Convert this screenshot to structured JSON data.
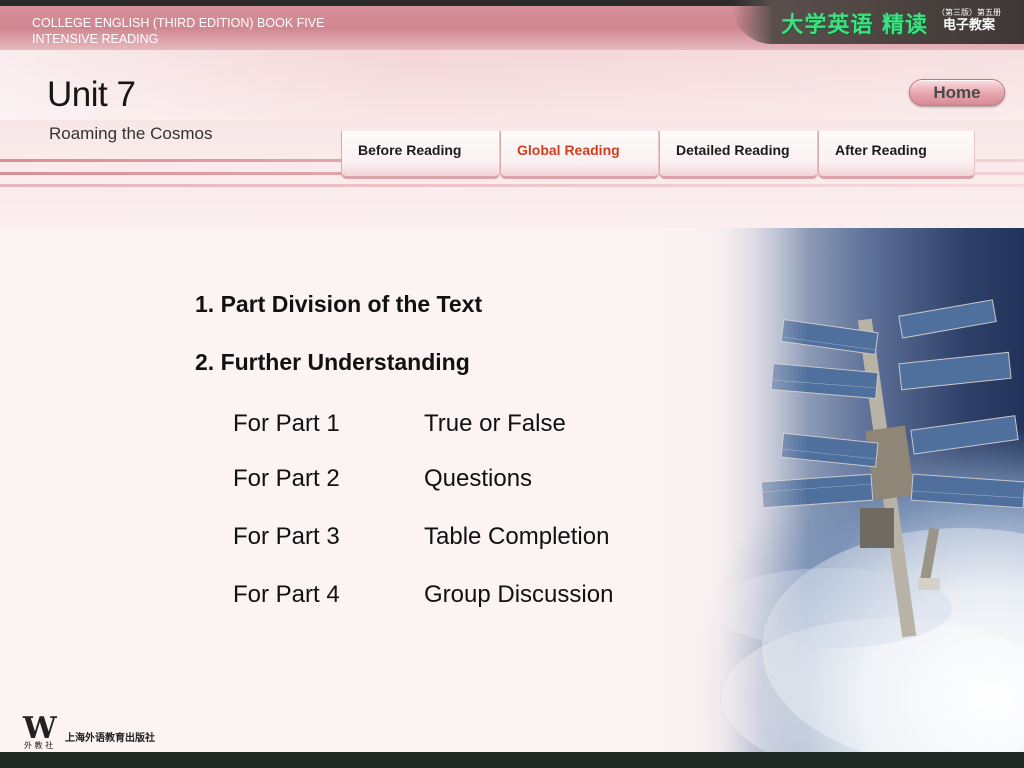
{
  "banner": {
    "course_line1": "COLLEGE ENGLISH (THIRD EDITION) BOOK FIVE",
    "course_line2": "INTENSIVE READING",
    "logo_main": "大学英语 精读",
    "logo_sub_line1": "（第三版）第五册",
    "logo_sub_line2": "电子教案"
  },
  "header": {
    "unit_title": "Unit 7",
    "unit_subtitle": "Roaming the Cosmos",
    "home_label": "Home"
  },
  "tabs": [
    {
      "label": "Before Reading",
      "active": false
    },
    {
      "label": "Global Reading",
      "active": true
    },
    {
      "label": "Detailed Reading",
      "active": false
    },
    {
      "label": "After Reading",
      "active": false
    }
  ],
  "content": {
    "heading1": "1. Part Division of the Text",
    "heading2": "2. Further Understanding",
    "rows": [
      {
        "part": "For Part 1",
        "activity": "True or False"
      },
      {
        "part": "For Part 2",
        "activity": "Questions"
      },
      {
        "part": "For Part 3",
        "activity": "Table Completion"
      },
      {
        "part": "For Part 4",
        "activity": "Group Discussion"
      }
    ]
  },
  "footer": {
    "publisher_mark": "W",
    "publisher_abbr": "外 教 社",
    "publisher_name": "上海外语教育出版社"
  },
  "colors": {
    "active_tab": "#d0401f",
    "logo_green": "#3fe07f",
    "banner_pink": "#cf8690"
  }
}
